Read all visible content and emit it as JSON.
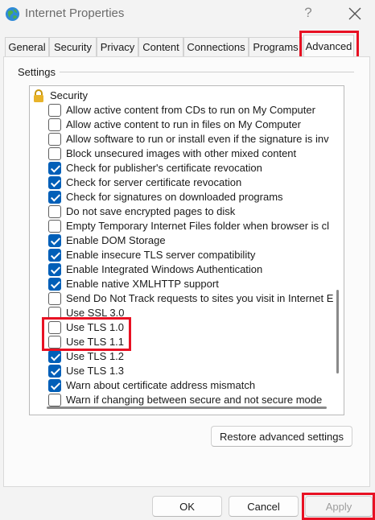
{
  "window": {
    "title": "Internet Properties",
    "help_label": "?",
    "icon": "globe-icon",
    "close_icon": "close-icon"
  },
  "tabs": [
    {
      "label": "General"
    },
    {
      "label": "Security"
    },
    {
      "label": "Privacy"
    },
    {
      "label": "Content"
    },
    {
      "label": "Connections"
    },
    {
      "label": "Programs"
    },
    {
      "label": "Advanced",
      "active": true
    }
  ],
  "settings": {
    "group_label": "Settings",
    "section_header": {
      "label": "Security",
      "icon": "lock-icon"
    },
    "items": [
      {
        "label": "Allow active content from CDs to run on My Computer",
        "checked": false
      },
      {
        "label": "Allow active content to run in files on My Computer",
        "checked": false
      },
      {
        "label": "Allow software to run or install even if the signature is inv",
        "checked": false
      },
      {
        "label": "Block unsecured images with other mixed content",
        "checked": false
      },
      {
        "label": "Check for publisher's certificate revocation",
        "checked": true
      },
      {
        "label": "Check for server certificate revocation",
        "checked": true
      },
      {
        "label": "Check for signatures on downloaded programs",
        "checked": true
      },
      {
        "label": "Do not save encrypted pages to disk",
        "checked": false
      },
      {
        "label": "Empty Temporary Internet Files folder when browser is cl",
        "checked": false
      },
      {
        "label": "Enable DOM Storage",
        "checked": true
      },
      {
        "label": "Enable insecure TLS server compatibility",
        "checked": true
      },
      {
        "label": "Enable Integrated Windows Authentication",
        "checked": true
      },
      {
        "label": "Enable native XMLHTTP support",
        "checked": true
      },
      {
        "label": "Send Do Not Track requests to sites you visit in Internet E",
        "checked": false
      },
      {
        "label": "Use SSL 3.0",
        "checked": false
      },
      {
        "label": "Use TLS 1.0",
        "checked": false
      },
      {
        "label": "Use TLS 1.1",
        "checked": false
      },
      {
        "label": "Use TLS 1.2",
        "checked": true
      },
      {
        "label": "Use TLS 1.3",
        "checked": true
      },
      {
        "label": "Warn about certificate address mismatch",
        "checked": true
      },
      {
        "label": "Warn if changing between secure and not secure mode",
        "checked": false
      }
    ]
  },
  "buttons": {
    "restore": "Restore advanced settings",
    "ok": "OK",
    "cancel": "Cancel",
    "apply": "Apply"
  },
  "colors": {
    "checkbox_checked": "#005fb8",
    "highlight": "#e81123"
  }
}
